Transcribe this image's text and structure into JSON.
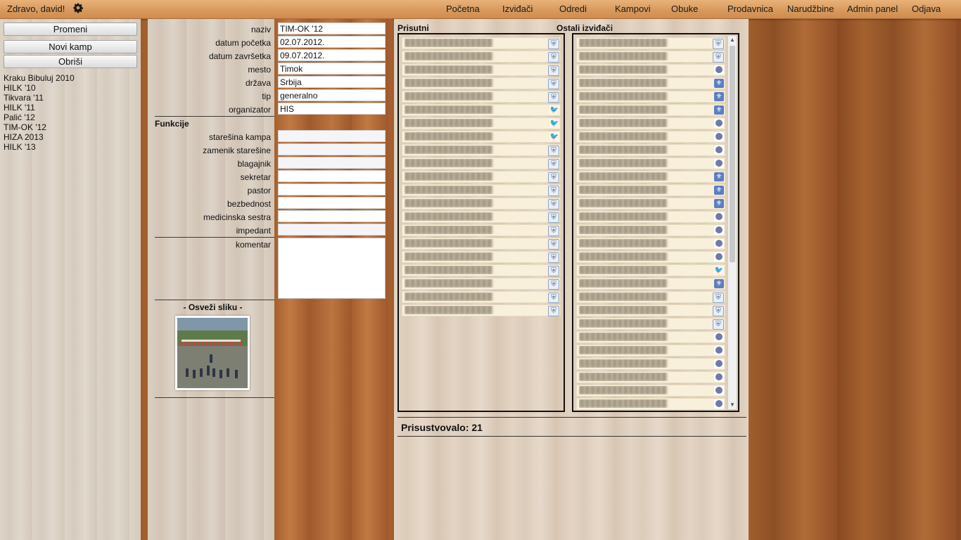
{
  "topbar": {
    "greeting": "Zdravo, david!",
    "nav": [
      "Početna",
      "Izviđači",
      "Odredi",
      "Kampovi",
      "Obuke",
      "Prodavnica",
      "Narudžbine",
      "Admin panel",
      "Odjava"
    ]
  },
  "sidebar": {
    "buttons": {
      "edit": "Promeni",
      "new_camp": "Novi kamp",
      "delete": "Obriši"
    },
    "camps": [
      "Kraku Bibuluj 2010",
      "HILK '10",
      "Tikvara '11",
      "HILK '11",
      "Palić '12",
      "TIM-OK '12",
      "HIZA 2013",
      "HILK '13"
    ]
  },
  "form": {
    "labels": {
      "naziv": "naziv",
      "datum_pocetka": "datum početka",
      "datum_zavrsetka": "datum završetka",
      "mesto": "mesto",
      "drzava": "država",
      "tip": "tip",
      "organizator": "organizator",
      "funkcije": "Funkcije",
      "starešina": "starešina kampa",
      "zamenik": "zamenik starešine",
      "blagajnik": "blagajnik",
      "sekretar": "sekretar",
      "pastor": "pastor",
      "bezbednost": "bezbednost",
      "medicinska": "medicinska sestra",
      "impedant": "impedant",
      "komentar": "komentar"
    },
    "values": {
      "naziv": "TIM-OK '12",
      "datum_pocetka": "02.07.2012.",
      "datum_zavrsetka": "09.07.2012.",
      "mesto": "Timok",
      "drzava": "Srbija",
      "tip": "generalno",
      "organizator": "HIS",
      "starešina": "",
      "zamenik": "",
      "blagajnik": "",
      "sekretar": "",
      "pastor": "",
      "bezbednost": "",
      "medicinska": "",
      "impedant": "",
      "komentar": ""
    },
    "refresh_photo": "- Osveži sliku -"
  },
  "lists": {
    "present_title": "Prisutni",
    "others_title": "Ostali izviđači",
    "present_icons": [
      "crest",
      "crest",
      "crest",
      "crest",
      "crest",
      "goose",
      "goose",
      "goose",
      "crest",
      "crest",
      "crest",
      "crest",
      "crest",
      "crest",
      "crest",
      "crest",
      "crest",
      "crest",
      "crest",
      "crest",
      "crest"
    ],
    "others_icons": [
      "crest",
      "crest",
      "circle",
      "fleur",
      "fleur",
      "fleur",
      "circle",
      "circle",
      "circle",
      "circle",
      "fleur",
      "fleur",
      "fleur",
      "circle",
      "circle",
      "circle",
      "circle",
      "goose",
      "fleur",
      "crest",
      "crest",
      "crest",
      "circle",
      "circle",
      "circle",
      "circle",
      "circle",
      "circle",
      "fleur"
    ]
  },
  "attendance": {
    "label": "Prisustvovalo: 21"
  },
  "colors": {
    "topbar": "#d99a5d",
    "row_bg": "#f8f0da",
    "fleur_bg": "#5d7ec2"
  }
}
